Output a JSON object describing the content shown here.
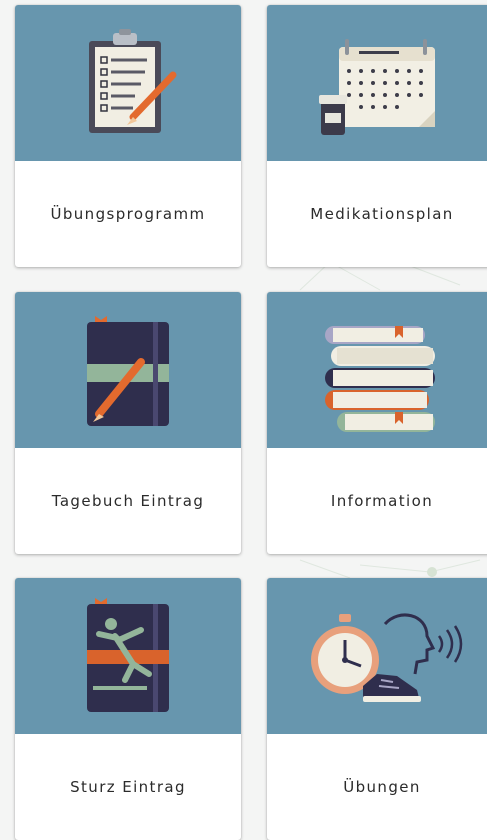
{
  "tiles": [
    {
      "label": "Übungsprogramm",
      "icon": "clipboard-checklist-icon"
    },
    {
      "label": "Medikationsplan",
      "icon": "calendar-pills-icon"
    },
    {
      "label": "Tagebuch Eintrag",
      "icon": "diary-pencil-icon"
    },
    {
      "label": "Information",
      "icon": "books-stack-icon"
    },
    {
      "label": "Sturz Eintrag",
      "icon": "fall-diary-icon"
    },
    {
      "label": "Übungen",
      "icon": "stopwatch-voice-shoe-icon"
    }
  ],
  "colors": {
    "tile_art": "#6796ae",
    "page_bg": "#f4f5f4",
    "label_text": "#2b2b2b"
  }
}
